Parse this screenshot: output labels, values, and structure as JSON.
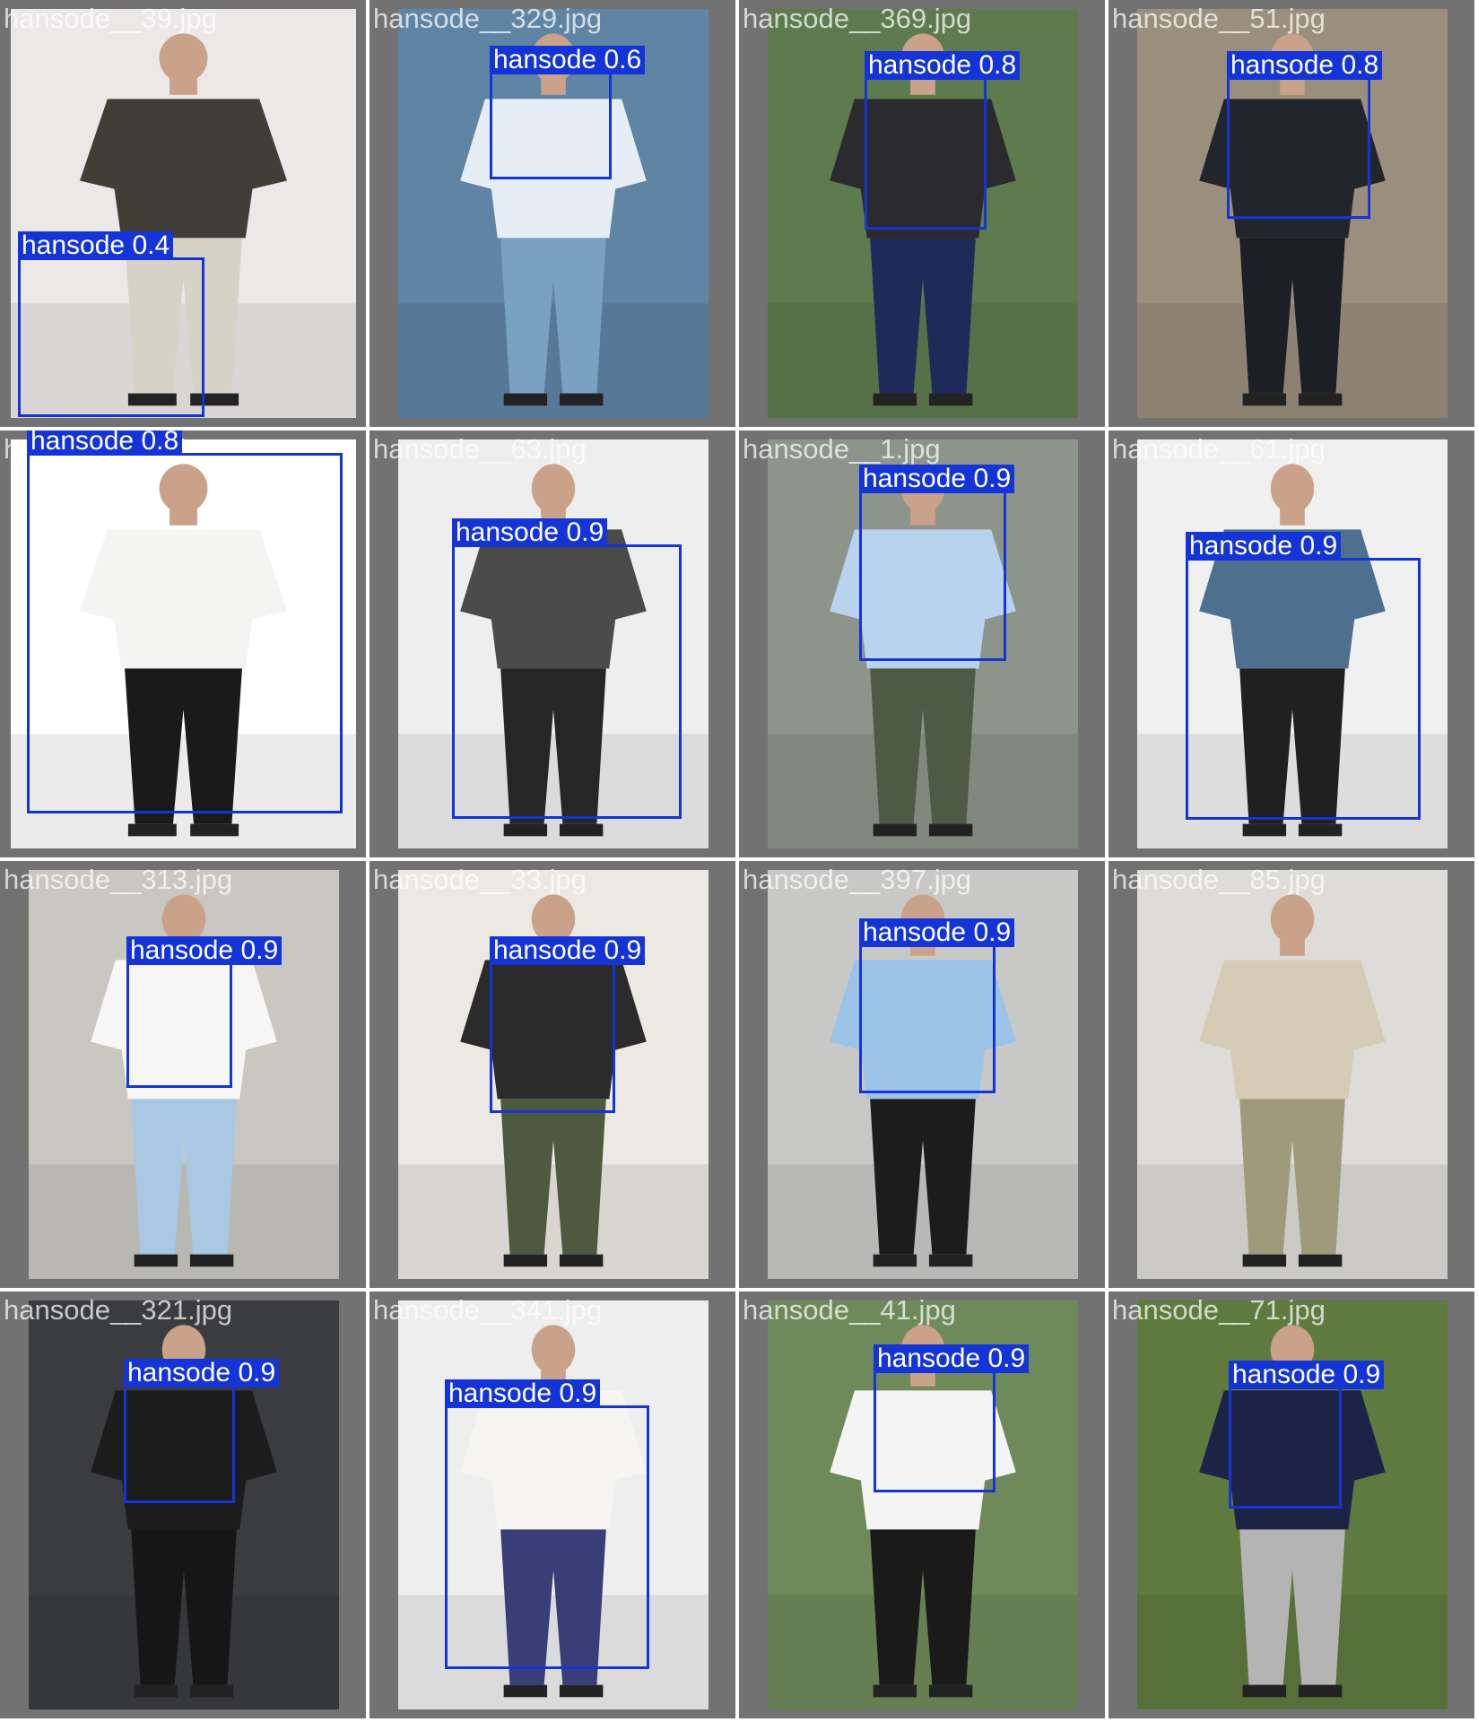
{
  "colors": {
    "tile_bg": "#727272",
    "box": "#1434d8",
    "label_text": "#ffffff"
  },
  "tiles": [
    {
      "file": "hansode__39.jpg",
      "bg": "#ece8e8",
      "garment": "#3f3f38",
      "pants": "#d8d2c6",
      "detections": [
        {
          "label": "hansode 0.4"
        }
      ]
    },
    {
      "file": "hansode__329.jpg",
      "bg": "#5f84a4",
      "garment": "#e7edf4",
      "pants": "#7aa0c2",
      "detections": [
        {
          "label": "hansode 0.6"
        }
      ]
    },
    {
      "file": "hansode__369.jpg",
      "bg": "#5e7a4f",
      "garment": "#2a2a2f",
      "pants": "#1e2b5a",
      "detections": [
        {
          "label": "hansode 0.8"
        }
      ]
    },
    {
      "file": "hansode__51.jpg",
      "bg": "#9a8e7c",
      "garment": "#22252c",
      "pants": "#1d1f27",
      "detections": [
        {
          "label": "hansode 0.8"
        }
      ]
    },
    {
      "file": "hansode__77.jpg",
      "bg": "#ffffff",
      "garment": "#f4f4f2",
      "pants": "#1a1a1a",
      "detections": [
        {
          "label": "hansode 0.8"
        }
      ]
    },
    {
      "file": "hansode__63.jpg",
      "bg": "#eeeeee",
      "garment": "#4a4b4a",
      "pants": "#262626",
      "detections": [
        {
          "label": "hansode 0.9"
        }
      ]
    },
    {
      "file": "hansode__1.jpg",
      "bg": "#8d958a",
      "garment": "#b9d3ef",
      "pants": "#4c5a46",
      "detections": [
        {
          "label": "hansode 0.9"
        }
      ]
    },
    {
      "file": "hansode__61.jpg",
      "bg": "#f0f0f0",
      "garment": "#4f6f8e",
      "pants": "#202020",
      "detections": [
        {
          "label": "hansode 0.9"
        }
      ]
    },
    {
      "file": "hansode__313.jpg",
      "bg": "#c9c7c0",
      "garment": "#f6f6f6",
      "pants": "#a8c8e4",
      "detections": [
        {
          "label": "hansode 0.9"
        }
      ]
    },
    {
      "file": "hansode__33.jpg",
      "bg": "#ece8e2",
      "garment": "#2b2b2b",
      "pants": "#4e5a40",
      "detections": [
        {
          "label": "hansode 0.9"
        }
      ]
    },
    {
      "file": "hansode__397.jpg",
      "bg": "#c8c8c6",
      "garment": "#9cc3e8",
      "pants": "#1c1c1c",
      "detections": [
        {
          "label": "hansode 0.9"
        }
      ]
    },
    {
      "file": "hansode__85.jpg",
      "bg": "#dedcd8",
      "garment": "#d6cbb4",
      "pants": "#a09a7c",
      "detections": []
    },
    {
      "file": "hansode__321.jpg",
      "bg": "#3a3c40",
      "garment": "#1c1c1c",
      "pants": "#161616",
      "detections": [
        {
          "label": "hansode 0.9"
        }
      ]
    },
    {
      "file": "hansode__341.jpg",
      "bg": "#eeeeee",
      "garment": "#f6f5f1",
      "pants": "#3a3e78",
      "detections": [
        {
          "label": "hansode 0.9"
        }
      ]
    },
    {
      "file": "hansode__41.jpg",
      "bg": "#6f8a5a",
      "garment": "#f4f4f4",
      "pants": "#1a1a1a",
      "detections": [
        {
          "label": "hansode 0.9"
        }
      ]
    },
    {
      "file": "hansode__71.jpg",
      "bg": "#5f7a3e",
      "garment": "#1d2347",
      "pants": "#b4b4b4",
      "detections": [
        {
          "label": "hansode 0.9"
        }
      ]
    }
  ]
}
